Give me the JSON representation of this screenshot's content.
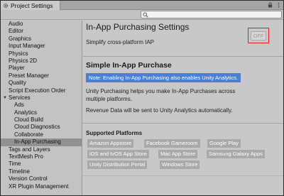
{
  "window": {
    "tab_title": "Project Settings",
    "search": {
      "value": "",
      "placeholder": ""
    }
  },
  "sidebar": {
    "items": [
      {
        "label": "Audio",
        "child": false,
        "selected": false
      },
      {
        "label": "Editor",
        "child": false,
        "selected": false
      },
      {
        "label": "Graphics",
        "child": false,
        "selected": false
      },
      {
        "label": "Input Manager",
        "child": false,
        "selected": false
      },
      {
        "label": "Physics",
        "child": false,
        "selected": false
      },
      {
        "label": "Physics 2D",
        "child": false,
        "selected": false
      },
      {
        "label": "Player",
        "child": false,
        "selected": false
      },
      {
        "label": "Preset Manager",
        "child": false,
        "selected": false
      },
      {
        "label": "Quality",
        "child": false,
        "selected": false
      },
      {
        "label": "Script Execution Order",
        "child": false,
        "selected": false
      },
      {
        "label": "Services",
        "child": false,
        "selected": false,
        "expanded": true
      },
      {
        "label": "Ads",
        "child": true,
        "selected": false
      },
      {
        "label": "Analytics",
        "child": true,
        "selected": false
      },
      {
        "label": "Cloud Build",
        "child": true,
        "selected": false
      },
      {
        "label": "Cloud Diagnostics",
        "child": true,
        "selected": false
      },
      {
        "label": "Collaborate",
        "child": true,
        "selected": false
      },
      {
        "label": "In-App Purchasing",
        "child": true,
        "selected": true
      },
      {
        "label": "Tags and Layers",
        "child": false,
        "selected": false
      },
      {
        "label": "TextMesh Pro",
        "child": false,
        "selected": false
      },
      {
        "label": "Time",
        "child": false,
        "selected": false
      },
      {
        "label": "Timeline",
        "child": false,
        "selected": false
      },
      {
        "label": "Version Control",
        "child": false,
        "selected": false
      },
      {
        "label": "XR Plugin Management",
        "child": false,
        "selected": false
      }
    ]
  },
  "main": {
    "title": "In-App Purchasing Settings",
    "subtitle": "Simplify cross-platform IAP",
    "toggle_label": "OFF",
    "section_title": "Simple In-App Purchase",
    "note": "Note: Enabling In-App Purchasing also enables Unity Analytics.",
    "paragraph1": "Unity Purchasing helps you make In-App Purchases across multiple platforms.",
    "paragraph2": "Revenue Data will be sent to Unity Analytics automatically.",
    "platforms_title": "Supported Platforms",
    "platforms": [
      "Amazon Appstore",
      "Facebook Gameroom",
      "Google Play",
      "iOS and tvOS App Store",
      "Mac App Store",
      "Samsung Galaxy Apps",
      "Unity Distribution Portal",
      "Windows Store"
    ]
  },
  "colors": {
    "note_bg": "#4a7fd4",
    "selected_bg": "#929292",
    "highlight_border": "#e02020",
    "chip_bg": "#a9a9a9"
  }
}
